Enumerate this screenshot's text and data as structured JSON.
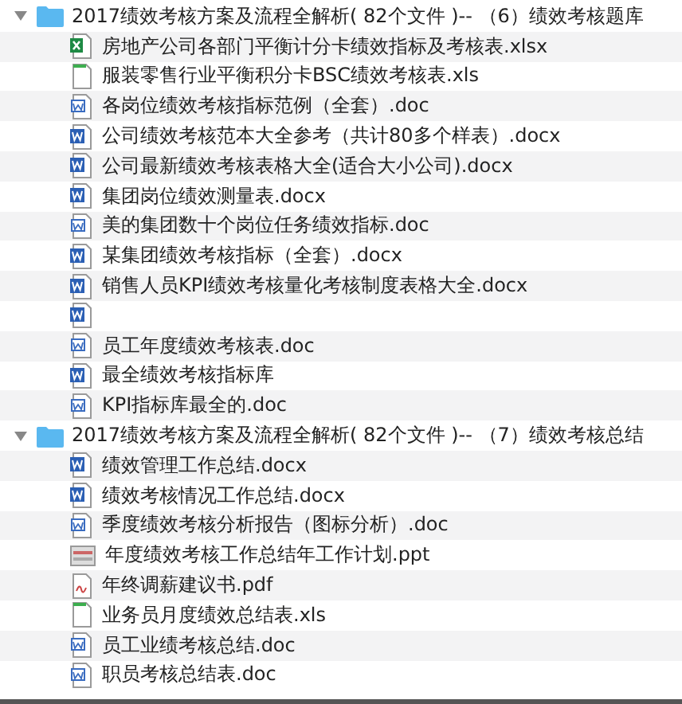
{
  "groups": [
    {
      "name": "2017绩效考核方案及流程全解析( 82个文件 )-- （6）绩效考核题库",
      "expanded": true,
      "files": [
        {
          "name": "房地产公司各部门平衡计分卡绩效指标及考核表.xlsx",
          "kind": "xlsx"
        },
        {
          "name": "服装零售行业平衡积分卡BSC绩效考核表.xls",
          "kind": "xls"
        },
        {
          "name": "各岗位绩效考核指标范例（全套）.doc",
          "kind": "doc"
        },
        {
          "name": "公司绩效考核范本大全参考（共计80多个样表）.docx",
          "kind": "docx"
        },
        {
          "name": "公司最新绩效考核表格大全(适合大小公司).docx",
          "kind": "docx"
        },
        {
          "name": "集团岗位绩效测量表.docx",
          "kind": "docx"
        },
        {
          "name": "美的集团数十个岗位任务绩效指标.doc",
          "kind": "doc"
        },
        {
          "name": "某集团绩效考核指标（全套）.docx",
          "kind": "docx"
        },
        {
          "name": "销售人员KPI绩效考核量化考核制度表格大全.docx",
          "kind": "docx"
        },
        {
          "kind": "docx"
        },
        {
          "name": "员工年度绩效考核表.doc",
          "kind": "doc"
        },
        {
          "name": "最全绩效考核指标库",
          "kind": "docx"
        },
        {
          "name": "KPI指标库最全的.doc",
          "kind": "doc"
        }
      ]
    },
    {
      "name": "2017绩效考核方案及流程全解析( 82个文件 )-- （7）绩效考核总结",
      "expanded": true,
      "files": [
        {
          "name": "绩效管理工作总结.docx",
          "kind": "docx"
        },
        {
          "name": "绩效考核情况工作总结.docx",
          "kind": "docx"
        },
        {
          "name": "季度绩效考核分析报告（图标分析）.doc",
          "kind": "doc"
        },
        {
          "name": "年度绩效考核工作总结年工作计划.ppt",
          "kind": "ppt"
        },
        {
          "name": "年终调薪建议书.pdf",
          "kind": "pdf"
        },
        {
          "name": "业务员月度绩效总结表.xls",
          "kind": "xls"
        },
        {
          "name": "员工业绩考核总结.doc",
          "kind": "doc"
        },
        {
          "name": "职员考核总结表.doc",
          "kind": "doc"
        }
      ]
    }
  ]
}
